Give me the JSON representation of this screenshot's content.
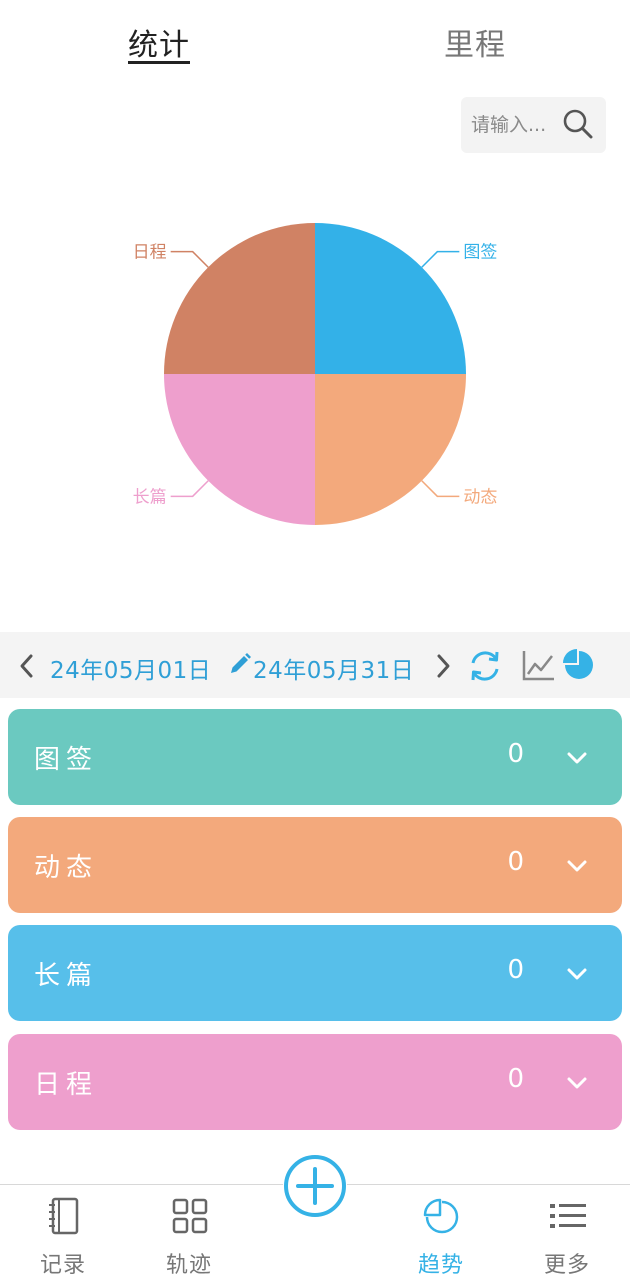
{
  "top_tabs": [
    {
      "label": "统计",
      "active": true
    },
    {
      "label": "里程",
      "active": false
    }
  ],
  "search": {
    "placeholder": "请输入..."
  },
  "chart_data": {
    "type": "pie",
    "slices": [
      {
        "label": "图签",
        "value": 25,
        "color": "#33b1e8"
      },
      {
        "label": "动态",
        "value": 25,
        "color": "#f3a97c"
      },
      {
        "label": "长篇",
        "value": 25,
        "color": "#ee9fcd"
      },
      {
        "label": "日程",
        "value": 25,
        "color": "#d08264"
      }
    ]
  },
  "date_range": {
    "start": "24年05月01日",
    "end": "24年05月31日"
  },
  "toolbar_icons": [
    "chevron-left-icon",
    "pencil-icon",
    "chevron-right-icon",
    "refresh-icon",
    "line-chart-icon",
    "pie-chart-icon"
  ],
  "categories": [
    {
      "label": "图签",
      "count": "0",
      "color": "#6bc9c0"
    },
    {
      "label": "动态",
      "count": "0",
      "color": "#f3a97c"
    },
    {
      "label": "长篇",
      "count": "0",
      "color": "#57bfea"
    },
    {
      "label": "日程",
      "count": "0",
      "color": "#ee9fcd"
    }
  ],
  "bottom_nav": [
    {
      "label": "记录",
      "icon": "notebook-icon",
      "active": false
    },
    {
      "label": "轨迹",
      "icon": "grid-icon",
      "active": false
    },
    {
      "label": "趋势",
      "icon": "pie-chart-icon",
      "active": true
    },
    {
      "label": "更多",
      "icon": "list-icon",
      "active": false
    }
  ],
  "fab_icon": "add-icon",
  "colors": {
    "accent": "#35b2e6",
    "datebar_bg": "#f4f4f4"
  }
}
